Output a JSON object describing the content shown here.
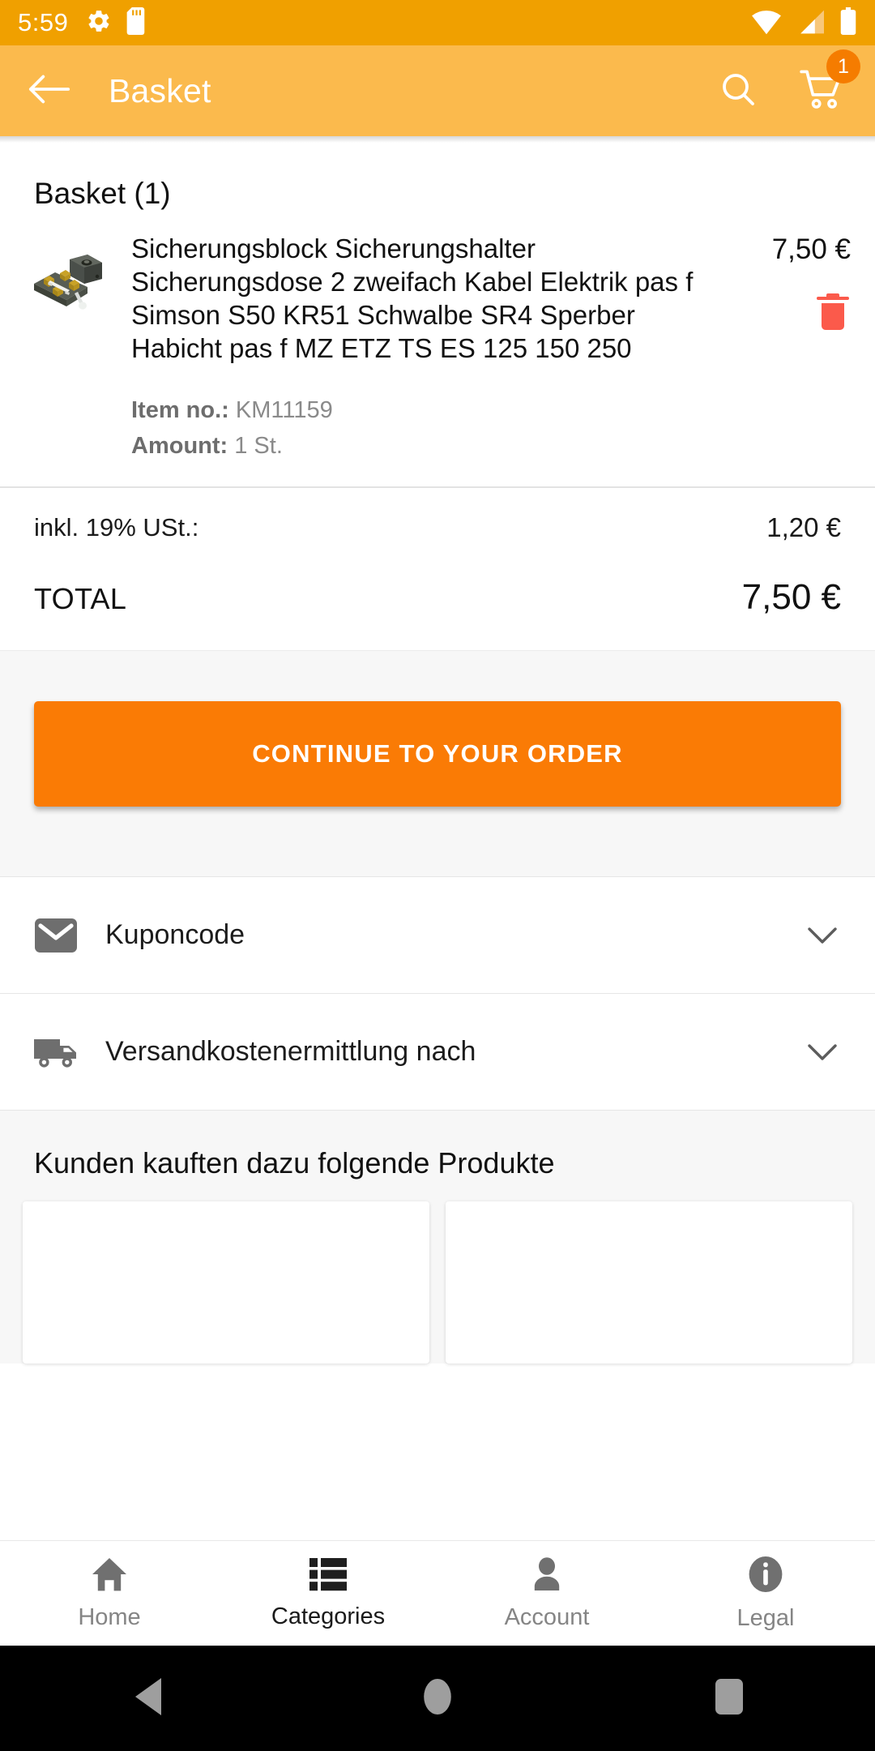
{
  "status_bar": {
    "time": "5:59",
    "icons": [
      "gear-icon",
      "sd-card-icon",
      "wifi-icon",
      "cellular-signal-icon",
      "battery-icon"
    ],
    "background_color": "#F0A000"
  },
  "app_bar": {
    "back_label": "back-arrow",
    "title": "Basket",
    "search_label": "search-icon",
    "cart_label": "cart-icon",
    "cart_badge": "1",
    "background_color": "#FBBA4D",
    "badge_color": "#F57C00"
  },
  "basket": {
    "heading": "Basket (1)",
    "items": [
      {
        "name": "Sicherungsblock Sicherungshalter Sicherungsdose 2 zweifach Kabel Elektrik pas f Simson S50 KR51 Schwalbe SR4 Sperber Habicht pas f MZ ETZ TS ES 125 150 250",
        "price": "7,50 €",
        "item_no_label": "Item no.:",
        "item_no_value": "KM11159",
        "amount_label": "Amount:",
        "amount_value": "1 St.",
        "delete_label": "delete-item"
      }
    ],
    "tax_label": "inkl. 19% USt.:",
    "tax_value": "1,20 €",
    "total_label": "TOTAL",
    "total_value": "7,50 €"
  },
  "cta": {
    "label": "CONTINUE TO YOUR ORDER",
    "color": "#FA7B05"
  },
  "accordions": [
    {
      "icon": "mail-icon",
      "label": "Kuponcode",
      "chevron": "chevron-down-icon"
    },
    {
      "icon": "truck-icon",
      "label": "Versandkostenermittlung nach",
      "chevron": "chevron-down-icon"
    }
  ],
  "recommendations": {
    "title": "Kunden kauften dazu folgende Produkte",
    "cards": [
      "",
      ""
    ]
  },
  "bottom_nav": {
    "items": [
      {
        "icon": "home-icon",
        "label": "Home",
        "active": false
      },
      {
        "icon": "categories-icon",
        "label": "Categories",
        "active": true
      },
      {
        "icon": "account-icon",
        "label": "Account",
        "active": false
      },
      {
        "icon": "info-icon",
        "label": "Legal",
        "active": false
      }
    ]
  },
  "system_nav": {
    "back": "system-back-icon",
    "home": "system-home-icon",
    "recents": "system-recents-icon"
  }
}
